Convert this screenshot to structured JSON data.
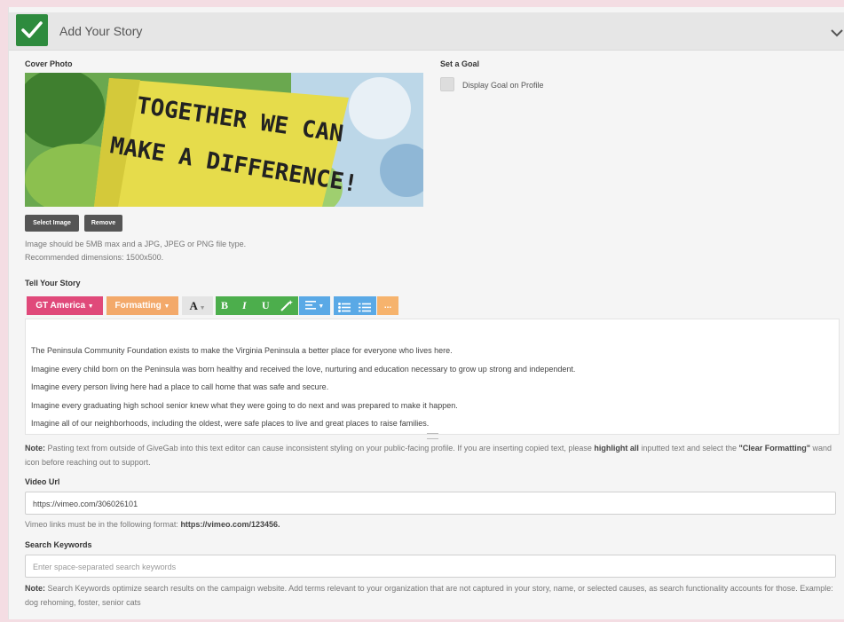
{
  "header": {
    "title": "Add Your Story"
  },
  "cover": {
    "label": "Cover Photo",
    "image_text_line1": "TOGETHER WE CAN",
    "image_text_line2": "MAKE A DIFFERENCE!",
    "select_label": "Select Image",
    "remove_label": "Remove",
    "hint_line1": "Image should be 5MB max and a JPG, JPEG or PNG file type.",
    "hint_line2": "Recommended dimensions: 1500x500."
  },
  "goal": {
    "label": "Set a Goal",
    "checkbox_label": "Display Goal on Profile"
  },
  "story": {
    "label": "Tell Your Story",
    "toolbar": {
      "font": "GT America",
      "formatting": "Formatting",
      "color": "A",
      "bold": "B",
      "italic": "I",
      "underline": "U",
      "more": "..."
    },
    "paragraphs": [
      "The Peninsula Community Foundation exists to make the Virginia Peninsula a better place for everyone who lives here.",
      "Imagine every child born on the Peninsula was born healthy and received the love, nurturing and education necessary to grow up strong and independent.",
      "Imagine every person living here had a place to call home that was safe and secure.",
      "Imagine every graduating high school senior knew what they were going to do next and was prepared to make it happen.",
      "Imagine all of our neighborhoods, including the oldest, were safe places to live and great places to raise families."
    ],
    "note_label": "Note:",
    "note_text1": "Pasting text from outside of GiveGab into this text editor can cause inconsistent styling on your public-facing profile. If you are inserting copied text, please",
    "note_bold1": "highlight all",
    "note_text2": "inputted text and select the",
    "note_bold2": "\"Clear Formatting\"",
    "note_text3": "wand icon before reaching out to support."
  },
  "video": {
    "label": "Video Url",
    "value": "https://vimeo.com/306026101",
    "hint_text": "Vimeo links must be in the following format:",
    "hint_bold": "https://vimeo.com/123456."
  },
  "keywords": {
    "label": "Search Keywords",
    "placeholder": "Enter space-separated search keywords",
    "note_label": "Note:",
    "note_text": "Search Keywords optimize search results on the campaign website. Add terms relevant to your organization that are not captured in your story, name, or selected causes, as search functionality accounts for those. Example: dog rehoming, foster, senior cats"
  },
  "colors": {
    "check_green": "#2e8b3e",
    "font_btn": "#e0497a",
    "format_btn": "#f3a96a",
    "green_btn": "#4cae4c",
    "blue_btn": "#5aa9e6",
    "orange_btn": "#f6b36d"
  }
}
